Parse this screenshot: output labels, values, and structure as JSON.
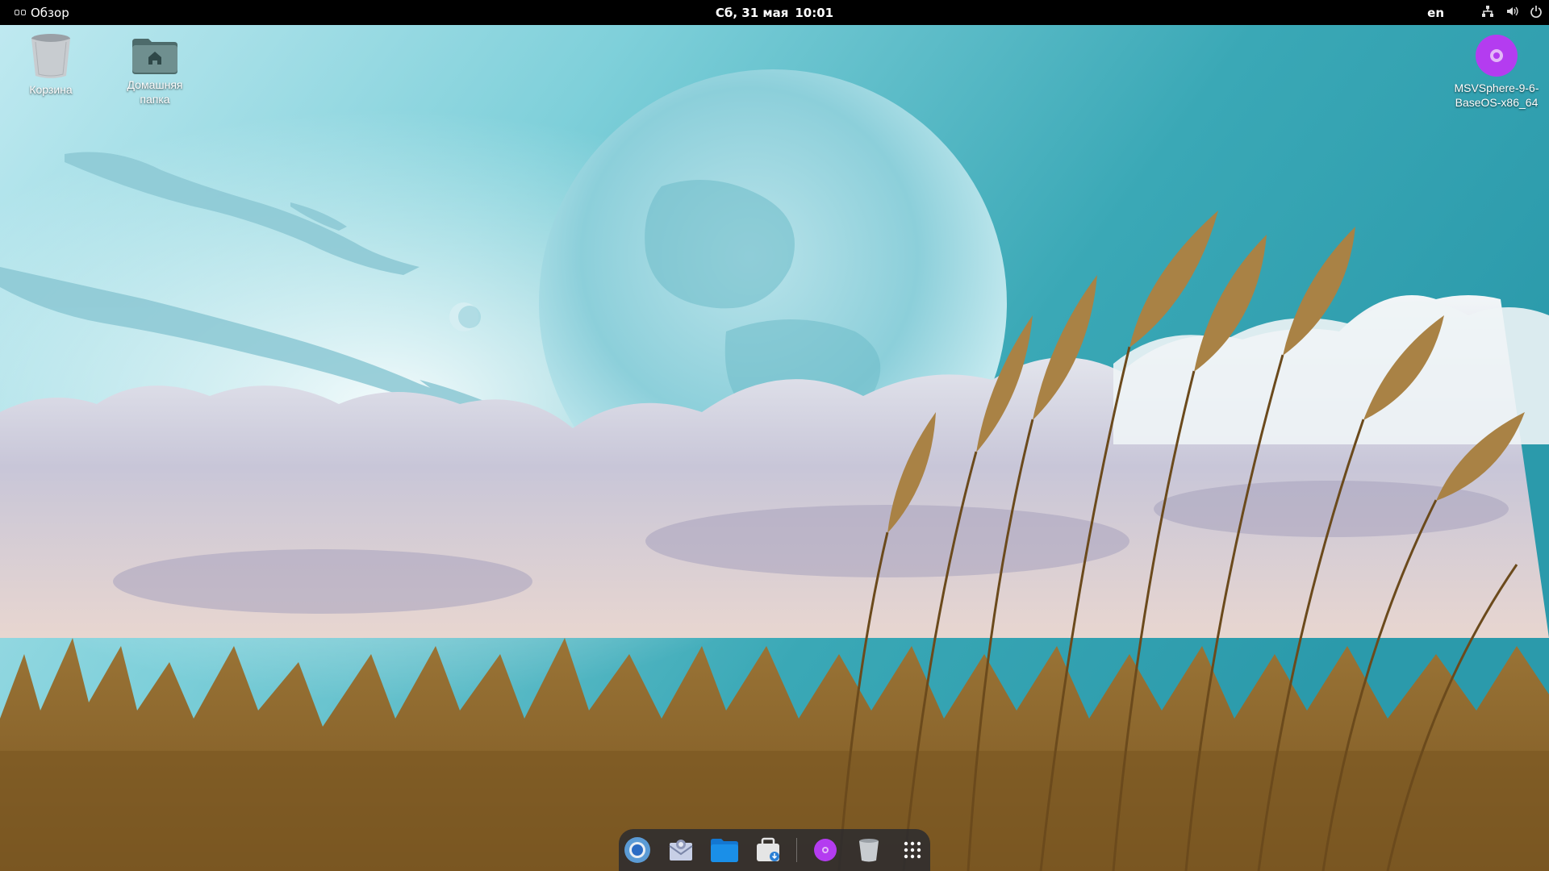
{
  "topbar": {
    "activities_label": "Обзор",
    "date": "Сб, 31 мая",
    "time": "10:01",
    "language": "en",
    "tray_icons": [
      "network-icon",
      "volume-icon",
      "power-icon"
    ]
  },
  "desktop": {
    "icons": [
      {
        "name": "trash",
        "label": "Корзина",
        "icon": "trash-icon"
      },
      {
        "name": "home",
        "label": "Домашняя папка",
        "icon": "home-folder-icon"
      },
      {
        "name": "disc",
        "label": "MSVSphere-9-6-BaseOS-x86_64",
        "icon": "optical-disc-icon"
      }
    ]
  },
  "dock": {
    "items": [
      {
        "name": "browser",
        "icon": "chromium-icon"
      },
      {
        "name": "mail",
        "icon": "mail-client-icon"
      },
      {
        "name": "files",
        "icon": "files-folder-icon"
      },
      {
        "name": "software",
        "icon": "software-store-icon"
      },
      {
        "name": "disc",
        "icon": "optical-disc-icon"
      },
      {
        "name": "trash",
        "icon": "trash-icon"
      },
      {
        "name": "app-grid",
        "icon": "app-grid-icon"
      }
    ]
  },
  "colors": {
    "topbar_bg": "#000000",
    "sky_teal": "#3aa8b6",
    "grass_brown": "#8a6428",
    "disc_purple": "#b43cf0",
    "folder_blue": "#1a8fe8"
  }
}
